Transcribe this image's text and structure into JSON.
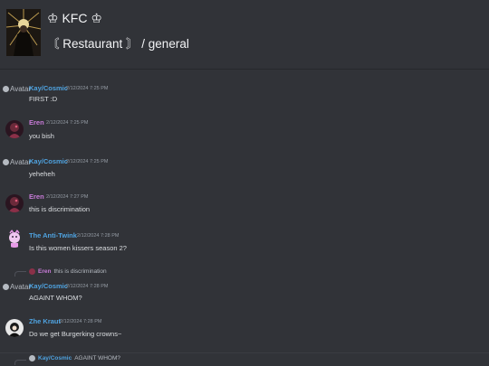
{
  "header": {
    "server_name": "♔ KFC ♔",
    "channel_name": "〘 Restaurant 〙 / general"
  },
  "broken_avatar_alt": "Avatar",
  "messages": [
    {
      "user": "Kay/Cosmic",
      "time": "2/12/2024 7:25 PM",
      "text": "FIRST :D",
      "color": "#4fa3e0"
    },
    {
      "user": "Eren",
      "time": "2/12/2024 7:25 PM",
      "text": "you bish",
      "color": "#c87bd8"
    },
    {
      "user": "Kay/Cosmic",
      "time": "2/12/2024 7:25 PM",
      "text": "yeheheh",
      "color": "#4fa3e0"
    },
    {
      "user": "Eren",
      "time": "2/12/2024 7:27 PM",
      "text": "this is discrimination",
      "color": "#c87bd8"
    },
    {
      "user": "The Anti-Twink",
      "time": "2/12/2024 7:28 PM",
      "text": "Is this women kissers season 2?",
      "color": "#4fa3e0"
    },
    {
      "user": "Kay/Cosmic",
      "time": "2/12/2024 7:28 PM",
      "text": "AGAINT WHOM?",
      "color": "#4fa3e0"
    },
    {
      "user": "Zhe Kraut",
      "time": "2/12/2024 7:28 PM",
      "text": "Do we get Burgerking crowns~",
      "color": "#4fa3e0"
    }
  ],
  "replies": [
    {
      "user": "Eren",
      "text": "this is discrimination",
      "color": "#c87bd8"
    },
    {
      "user": "Kay/Cosmic",
      "text": "AGAINT WHOM?",
      "color": "#4fa3e0"
    }
  ]
}
